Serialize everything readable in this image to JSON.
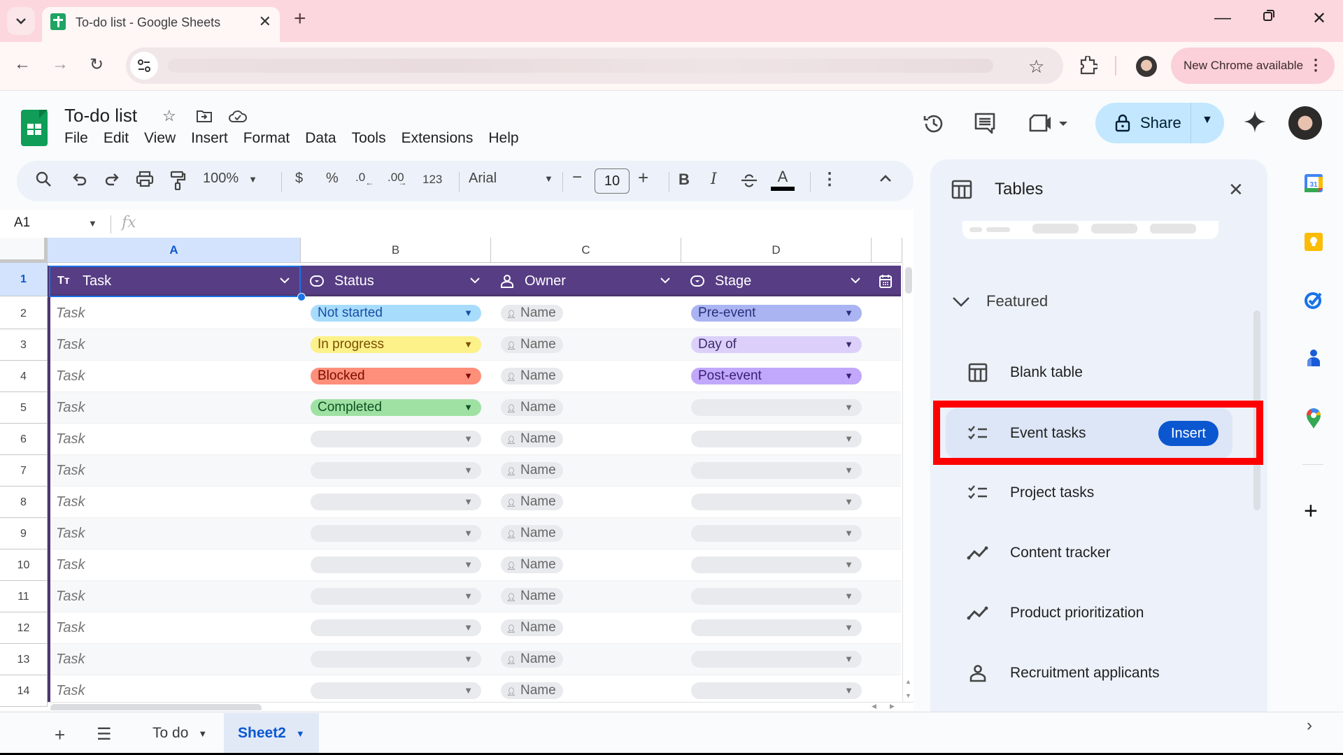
{
  "browser": {
    "tab_title": "To-do list - Google Sheets",
    "new_chrome_label": "New Chrome available"
  },
  "app": {
    "doc_title": "To-do list",
    "menu": [
      "File",
      "Edit",
      "View",
      "Insert",
      "Format",
      "Data",
      "Tools",
      "Extensions",
      "Help"
    ],
    "share_label": "Share"
  },
  "format_toolbar": {
    "zoom": "100%",
    "currency": "$",
    "percent": "%",
    "decrease_decimal": ".0",
    "increase_decimal": ".00",
    "number_format": "123",
    "font": "Arial",
    "font_size": "10",
    "bold": "B",
    "italic": "I",
    "text_color_glyph": "A"
  },
  "formula_bar": {
    "name_box": "A1",
    "fx": "fx",
    "value": ""
  },
  "grid": {
    "columns": [
      "A",
      "B",
      "C",
      "D"
    ],
    "selected_column": "A",
    "selected_row": "1",
    "table_headers": [
      {
        "label": "Task",
        "icon": "text-type-icon"
      },
      {
        "label": "Status",
        "icon": "dropdown-type-icon"
      },
      {
        "label": "Owner",
        "icon": "person-type-icon"
      },
      {
        "label": "Stage",
        "icon": "dropdown-type-icon"
      }
    ],
    "rows": [
      {
        "num": "2",
        "task": "Task",
        "status": "Not started",
        "owner": "Name",
        "stage": "Pre-event"
      },
      {
        "num": "3",
        "task": "Task",
        "status": "In progress",
        "owner": "Name",
        "stage": "Day of"
      },
      {
        "num": "4",
        "task": "Task",
        "status": "Blocked",
        "owner": "Name",
        "stage": "Post-event"
      },
      {
        "num": "5",
        "task": "Task",
        "status": "Completed",
        "owner": "Name",
        "stage": ""
      },
      {
        "num": "6",
        "task": "Task",
        "status": "",
        "owner": "Name",
        "stage": ""
      },
      {
        "num": "7",
        "task": "Task",
        "status": "",
        "owner": "Name",
        "stage": ""
      },
      {
        "num": "8",
        "task": "Task",
        "status": "",
        "owner": "Name",
        "stage": ""
      },
      {
        "num": "9",
        "task": "Task",
        "status": "",
        "owner": "Name",
        "stage": ""
      },
      {
        "num": "10",
        "task": "Task",
        "status": "",
        "owner": "Name",
        "stage": ""
      },
      {
        "num": "11",
        "task": "Task",
        "status": "",
        "owner": "Name",
        "stage": ""
      },
      {
        "num": "12",
        "task": "Task",
        "status": "",
        "owner": "Name",
        "stage": ""
      },
      {
        "num": "13",
        "task": "Task",
        "status": "",
        "owner": "Name",
        "stage": ""
      },
      {
        "num": "14",
        "task": "Task",
        "status": "",
        "owner": "Name",
        "stage": ""
      }
    ],
    "chip_colors": {
      "Not started": {
        "bg": "#a8dcfc",
        "fg": "#174ea6"
      },
      "In progress": {
        "bg": "#fdf18a",
        "fg": "#7a4f01"
      },
      "Blocked": {
        "bg": "#fe8f7a",
        "fg": "#7c0a02"
      },
      "Completed": {
        "bg": "#9fe1a3",
        "fg": "#0d5223"
      },
      "Pre-event": {
        "bg": "#aab4f3",
        "fg": "#2a2f7a"
      },
      "Day of": {
        "bg": "#dcd0fb",
        "fg": "#3c2a6b"
      },
      "Post-event": {
        "bg": "#c2a8fa",
        "fg": "#3a1e78"
      },
      "": {
        "bg": "#e8eaed",
        "fg": "#666666"
      }
    }
  },
  "sheets": {
    "tabs": [
      {
        "label": "To do",
        "active": false
      },
      {
        "label": "Sheet2",
        "active": true
      }
    ]
  },
  "tables_panel": {
    "title": "Tables",
    "section": "Featured",
    "templates": [
      {
        "label": "Blank table",
        "icon": "table-icon"
      },
      {
        "label": "Event tasks",
        "icon": "checklist-icon",
        "action": "Insert",
        "highlighted": true
      },
      {
        "label": "Project tasks",
        "icon": "checklist-icon"
      },
      {
        "label": "Content tracker",
        "icon": "trend-line-icon"
      },
      {
        "label": "Product prioritization",
        "icon": "trend-line-icon"
      },
      {
        "label": "Recruitment applicants",
        "icon": "person-icon"
      }
    ]
  },
  "side_rail": {
    "apps": [
      "calendar",
      "keep",
      "tasks",
      "contacts",
      "maps"
    ],
    "calendar_day": "31"
  },
  "colors": {
    "table_header": "#573d84",
    "accent_blue": "#0b57d0",
    "highlight_red": "#ff0000",
    "share_bg": "#c2e7ff"
  }
}
